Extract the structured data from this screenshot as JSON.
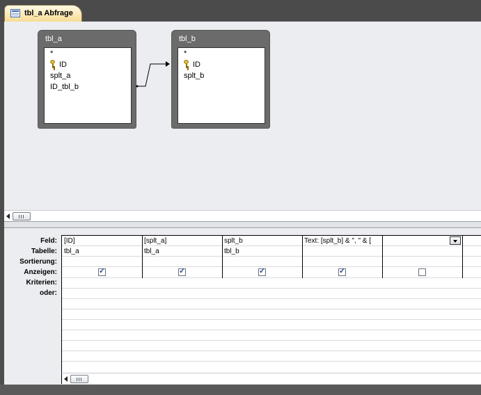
{
  "tab": {
    "title": "tbl_a Abfrage",
    "icon": "query-design-icon"
  },
  "tables": [
    {
      "name": "tbl_a",
      "fields": [
        {
          "name": "*",
          "primary_key": false
        },
        {
          "name": "ID",
          "primary_key": true
        },
        {
          "name": "splt_a",
          "primary_key": false
        },
        {
          "name": "ID_tbl_b",
          "primary_key": false
        }
      ]
    },
    {
      "name": "tbl_b",
      "fields": [
        {
          "name": "*",
          "primary_key": false
        },
        {
          "name": "ID",
          "primary_key": true
        },
        {
          "name": "splt_b",
          "primary_key": false
        }
      ]
    }
  ],
  "grid": {
    "row_labels": [
      "Feld:",
      "Tabelle:",
      "Sortierung:",
      "Anzeigen:",
      "Kriterien:",
      "oder:"
    ],
    "columns": [
      {
        "field": "[ID]",
        "table": "tbl_a",
        "sort": "",
        "show": true
      },
      {
        "field": "[splt_a]",
        "table": "tbl_a",
        "sort": "",
        "show": true
      },
      {
        "field": "splt_b",
        "table": "tbl_b",
        "sort": "",
        "show": true
      },
      {
        "field": "Text: [splt_b] & \", \" & [",
        "table": "",
        "sort": "",
        "show": true
      },
      {
        "field": "",
        "table": "",
        "sort": "",
        "show": false,
        "has_dropdown": true
      }
    ]
  }
}
